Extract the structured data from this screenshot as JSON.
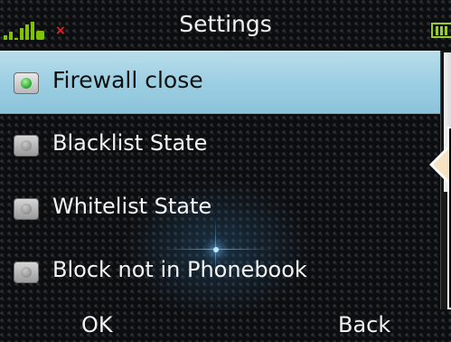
{
  "header": {
    "title": "Settings",
    "signal_label": "signal-bars",
    "no_network_mark": "×"
  },
  "list": {
    "items": [
      {
        "label": "Firewall close",
        "selected": true
      },
      {
        "label": "Blacklist State",
        "selected": false
      },
      {
        "label": "Whitelist State",
        "selected": false
      },
      {
        "label": "Block not in Phonebook",
        "selected": false
      }
    ]
  },
  "softkeys": {
    "left": "OK",
    "right": "Back"
  },
  "colors": {
    "selection": "#9ccfe3",
    "radio_active": "#24a52c",
    "signal": "#7ec400",
    "no_network": "#e0262c"
  }
}
